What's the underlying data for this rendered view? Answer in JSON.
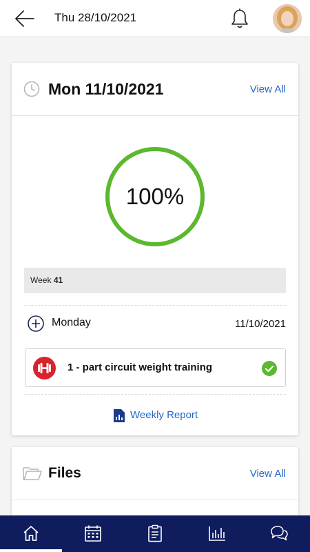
{
  "header": {
    "title": "Thu 28/10/2021",
    "back_icon": "arrow-left-icon",
    "notification_icon": "bell-icon",
    "avatar_icon": "user-avatar"
  },
  "summary_card": {
    "title": "Mon 11/10/2021",
    "view_all_label": "View All",
    "progress": {
      "percent_label": "100%",
      "value": 100,
      "ring_color": "#5cb82f"
    },
    "week": {
      "prefix": "Week",
      "number": "41"
    },
    "day": {
      "name": "Monday",
      "date": "11/10/2021"
    },
    "activities": [
      {
        "label": "1 - part circuit weight training",
        "icon": "dumbbell-icon",
        "icon_color": "#d9232d",
        "status": "completed",
        "status_color": "#5cb82f"
      }
    ],
    "weekly_report_label": "Weekly Report"
  },
  "files_card": {
    "title": "Files",
    "view_all_label": "View All"
  },
  "bottom_nav": {
    "background": "#0f1c5e",
    "items": [
      {
        "icon": "home-icon",
        "active": true
      },
      {
        "icon": "calendar-icon",
        "active": false
      },
      {
        "icon": "clipboard-icon",
        "active": false
      },
      {
        "icon": "bar-chart-icon",
        "active": false
      },
      {
        "icon": "chat-icon",
        "active": false
      }
    ]
  },
  "colors": {
    "accent_link": "#2467c7",
    "success": "#5cb82f"
  }
}
